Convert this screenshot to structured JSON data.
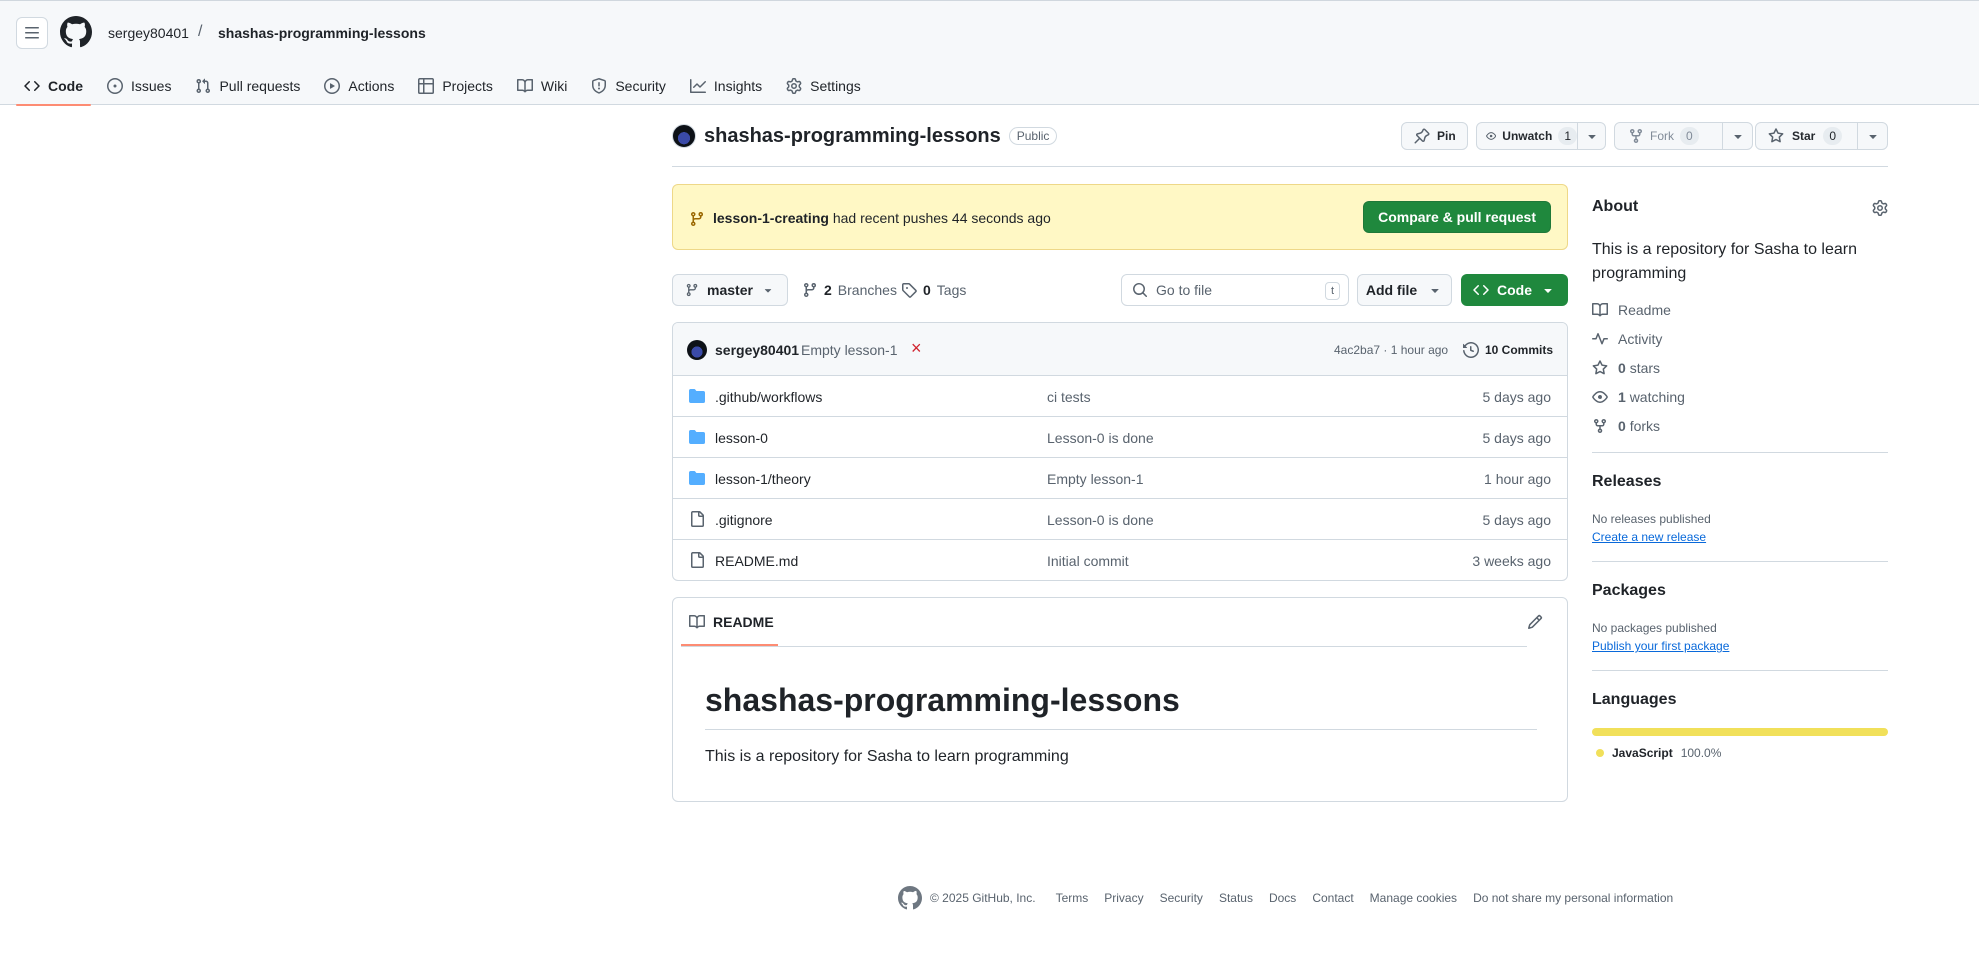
{
  "header": {
    "owner": "sergey80401",
    "separator": "/",
    "repo": "shashas-programming-lessons"
  },
  "nav": {
    "tabs": [
      {
        "label": "Code",
        "icon": "code-icon",
        "active": true
      },
      {
        "label": "Issues",
        "icon": "issue-icon"
      },
      {
        "label": "Pull requests",
        "icon": "pull-request-icon"
      },
      {
        "label": "Actions",
        "icon": "play-icon"
      },
      {
        "label": "Projects",
        "icon": "table-icon"
      },
      {
        "label": "Wiki",
        "icon": "book-icon"
      },
      {
        "label": "Security",
        "icon": "shield-icon"
      },
      {
        "label": "Insights",
        "icon": "graph-icon"
      },
      {
        "label": "Settings",
        "icon": "gear-icon"
      }
    ]
  },
  "repo": {
    "name": "shashas-programming-lessons",
    "visibility": "Public",
    "pin_label": "Pin",
    "unwatch_label": "Unwatch",
    "watch_count": "1",
    "fork_label": "Fork",
    "fork_count": "0",
    "star_label": "Star",
    "star_count": "0"
  },
  "banner": {
    "branch": "lesson-1-creating",
    "text": "had recent pushes 44 seconds ago",
    "button": "Compare & pull request",
    "bg_color": "#fff8c5"
  },
  "toolbar": {
    "branch": "master",
    "branches_count": "2",
    "branches_label": "Branches",
    "tags_count": "0",
    "tags_label": "Tags",
    "goto_placeholder": "Go to file",
    "goto_key": "t",
    "add_file": "Add file",
    "code": "Code"
  },
  "commit": {
    "user": "sergey80401",
    "message": "Empty lesson-1",
    "status": "×",
    "meta": "4ac2ba7 · 1 hour ago",
    "commits_label": "10 Commits"
  },
  "files": [
    {
      "type": "folder",
      "name": ".github/workflows",
      "commit": "ci tests",
      "age": "5 days ago"
    },
    {
      "type": "folder",
      "name": "lesson-0",
      "commit": "Lesson-0 is done",
      "age": "5 days ago"
    },
    {
      "type": "folder",
      "name": "lesson-1/theory",
      "commit": "Empty lesson-1",
      "age": "1 hour ago"
    },
    {
      "type": "file",
      "name": ".gitignore",
      "commit": "Lesson-0 is done",
      "age": "5 days ago"
    },
    {
      "type": "file",
      "name": "README.md",
      "commit": "Initial commit",
      "age": "3 weeks ago"
    }
  ],
  "readme": {
    "tab_label": "README",
    "heading": "shashas-programming-lessons",
    "body": "This is a repository for Sasha to learn programming"
  },
  "sidebar": {
    "about_title": "About",
    "about_desc": "This is a repository for Sasha to learn programming",
    "links": [
      {
        "icon": "book-icon",
        "count": "",
        "label": "Readme"
      },
      {
        "icon": "pulse-icon",
        "count": "",
        "label": "Activity"
      },
      {
        "icon": "star-icon",
        "count": "0",
        "label": "stars"
      },
      {
        "icon": "eye-icon",
        "count": "1",
        "label": "watching"
      },
      {
        "icon": "fork-icon",
        "count": "0",
        "label": "forks"
      }
    ],
    "releases_title": "Releases",
    "releases_text": "No releases published",
    "releases_link": "Create a new release",
    "packages_title": "Packages",
    "packages_text": "No packages published",
    "packages_link": "Publish your first package",
    "languages_title": "Languages",
    "language_name": "JavaScript",
    "language_percent": "100.0%",
    "language_color": "#f1e05a"
  },
  "footer": {
    "copyright": "© 2025 GitHub, Inc.",
    "links": [
      "Terms",
      "Privacy",
      "Security",
      "Status",
      "Docs",
      "Contact",
      "Manage cookies",
      "Do not share my personal information"
    ]
  },
  "colors": {
    "accent_green": "#1f883d",
    "tab_underline": "#fd8c73",
    "link_blue": "#0969da"
  }
}
